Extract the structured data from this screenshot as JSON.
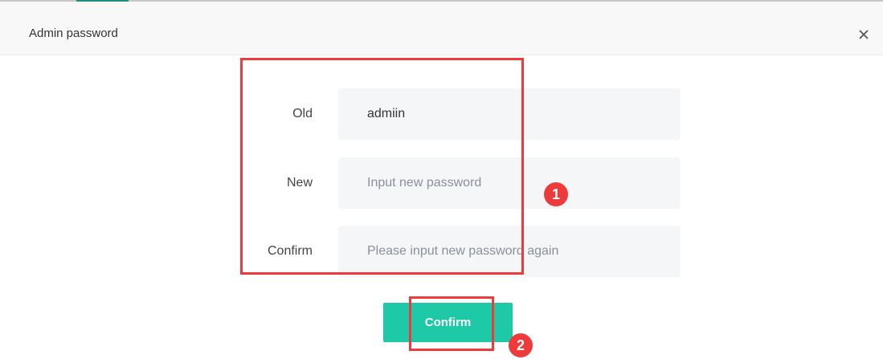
{
  "dialog": {
    "title": "Admin password",
    "close_icon": "close-icon"
  },
  "form": {
    "old": {
      "label": "Old",
      "value": "admiin"
    },
    "new": {
      "label": "New",
      "placeholder": "Input new password"
    },
    "confirm": {
      "label": "Confirm",
      "placeholder": "Please input new password again"
    }
  },
  "confirm_button": {
    "label": "Confirm"
  },
  "annotations": {
    "step1": "1",
    "step2": "2",
    "color": "#ee3a3a"
  },
  "colors": {
    "accent": "#1ec9a8",
    "input_bg": "#f5f6f8"
  }
}
